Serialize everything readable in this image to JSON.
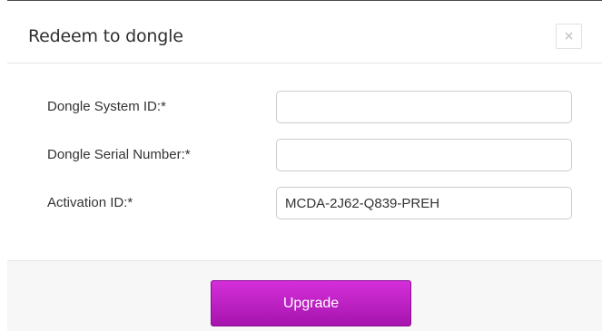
{
  "dialog": {
    "title": "Redeem to dongle",
    "close_label": "×"
  },
  "form": {
    "fields": [
      {
        "label": "Dongle System ID:*",
        "value": ""
      },
      {
        "label": "Dongle Serial Number:*",
        "value": ""
      },
      {
        "label": "Activation ID:*",
        "value": "MCDA-2J62-Q839-PREH"
      }
    ]
  },
  "footer": {
    "upgrade_label": "Upgrade"
  },
  "colors": {
    "accent": "#c021c8",
    "title_text": "#2f2f2f",
    "footer_bg": "#f7f7f7"
  }
}
